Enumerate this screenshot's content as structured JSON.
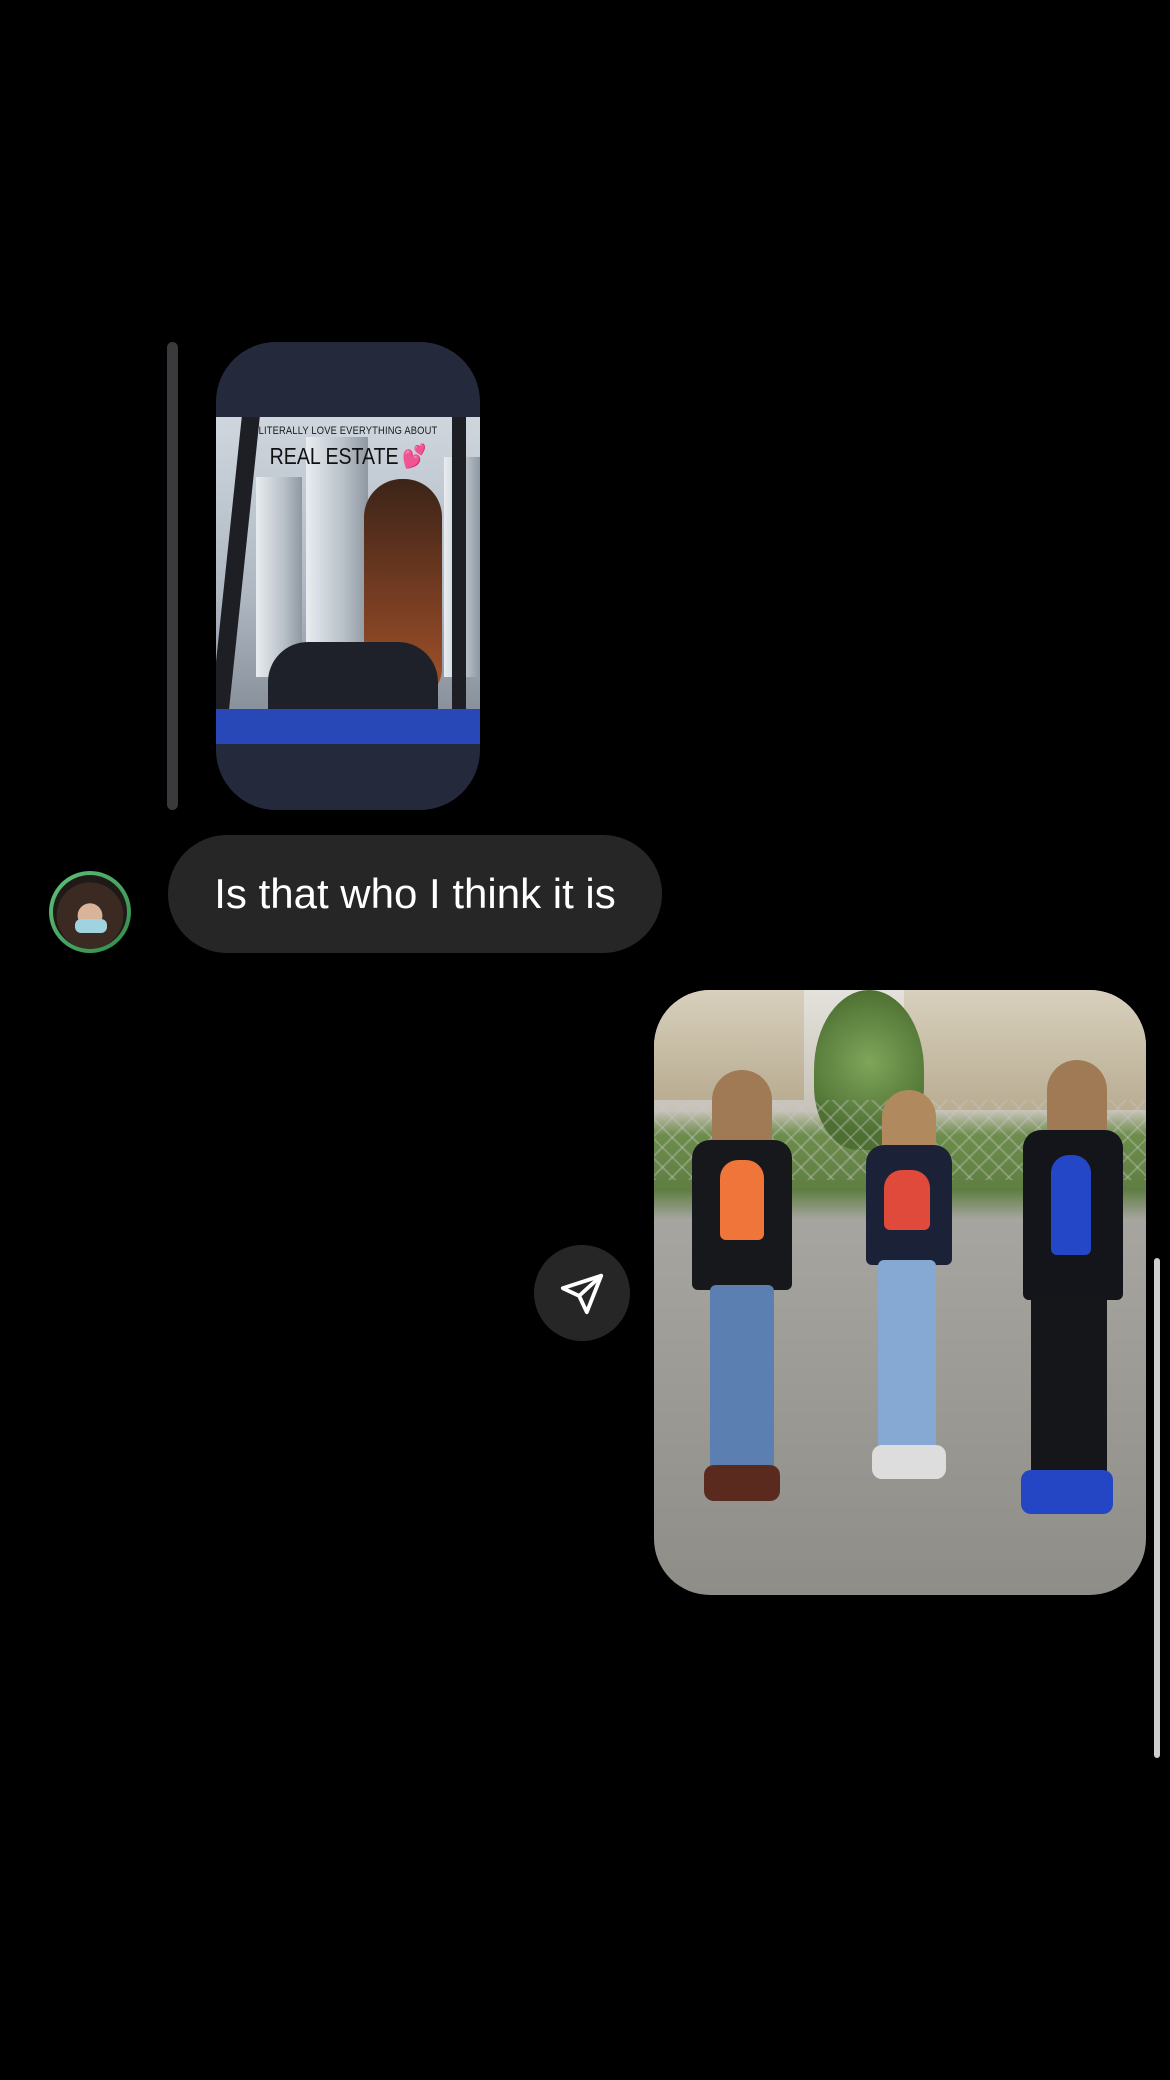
{
  "story_reply": {
    "caption_top": "LITERALLY LOVE EVERYTHING ABOUT",
    "caption_main": "REAL ESTATE",
    "caption_emoji": "💕"
  },
  "messages": [
    {
      "direction": "received",
      "type": "text",
      "text": "Is that who I think it is"
    },
    {
      "direction": "sent",
      "type": "photo"
    }
  ],
  "icons": {
    "share": "paper-plane-icon"
  },
  "colors": {
    "background": "#000000",
    "bubble_received": "#262626",
    "story_card": "#242a3c",
    "text": "#ffffff"
  }
}
